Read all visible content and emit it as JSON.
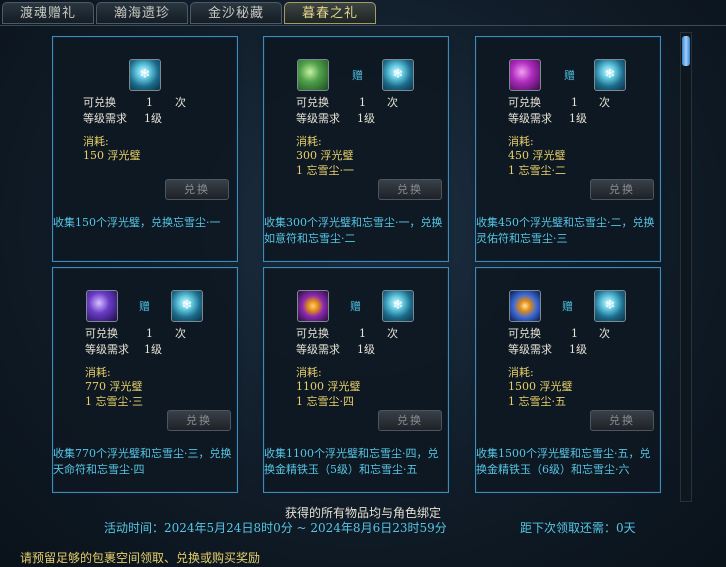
{
  "tabs": [
    "渡魂赠礼",
    "瀚海遗珍",
    "金沙秘藏",
    "暮春之礼"
  ],
  "active_tab": 3,
  "labels": {
    "exchangeable": "可兑换",
    "times_unit": "次",
    "level_req": "等级需求",
    "consume": "消耗:",
    "gift": "赠",
    "button": "兑换"
  },
  "cards": [
    {
      "icons": [
        "snow-crystal"
      ],
      "exchange_count": "1",
      "level": "1级",
      "cost_lines": [
        "150 浮光璧"
      ],
      "description": "收集150个浮光璧，兑换忘雪尘·一"
    },
    {
      "icons": [
        "green-talisman",
        "snow-crystal"
      ],
      "exchange_count": "1",
      "level": "1级",
      "cost_lines": [
        "300 浮光璧",
        "1 忘雪尘·一"
      ],
      "description": "收集300个浮光璧和忘雪尘·一，兑换如意符和忘雪尘·二"
    },
    {
      "icons": [
        "magenta-talisman",
        "snow-crystal"
      ],
      "exchange_count": "1",
      "level": "1级",
      "cost_lines": [
        "450 浮光璧",
        "1 忘雪尘·二"
      ],
      "description": "收集450个浮光璧和忘雪尘·二，兑换灵佑符和忘雪尘·三"
    },
    {
      "icons": [
        "violet-talisman",
        "snow-crystal"
      ],
      "exchange_count": "1",
      "level": "1级",
      "cost_lines": [
        "770 浮光璧",
        "1 忘雪尘·三"
      ],
      "description": "收集770个浮光璧和忘雪尘·三，兑换天命符和忘雪尘·四"
    },
    {
      "icons": [
        "purple-jade-orb",
        "snow-crystal"
      ],
      "exchange_count": "1",
      "level": "1级",
      "cost_lines": [
        "1100 浮光璧",
        "1 忘雪尘·四"
      ],
      "description": "收集1100个浮光璧和忘雪尘·四，兑换金精铁玉（5级）和忘雪尘·五"
    },
    {
      "icons": [
        "blue-jade-orb",
        "snow-crystal"
      ],
      "exchange_count": "1",
      "level": "1级",
      "cost_lines": [
        "1500 浮光璧",
        "1 忘雪尘·五"
      ],
      "description": "收集1500个浮光璧和忘雪尘·五，兑换金精铁玉（6级）和忘雪尘·六"
    }
  ],
  "footer": {
    "bind_note": "获得的所有物品均与角色绑定",
    "activity_time": "活动时间：2024年5月24日8时0分 ~ 2024年8月6日23时59分",
    "next_claim": "距下次领取还需：0天",
    "bottom_notice": "请预留足够的包裹空间领取、兑换或购买奖励"
  }
}
